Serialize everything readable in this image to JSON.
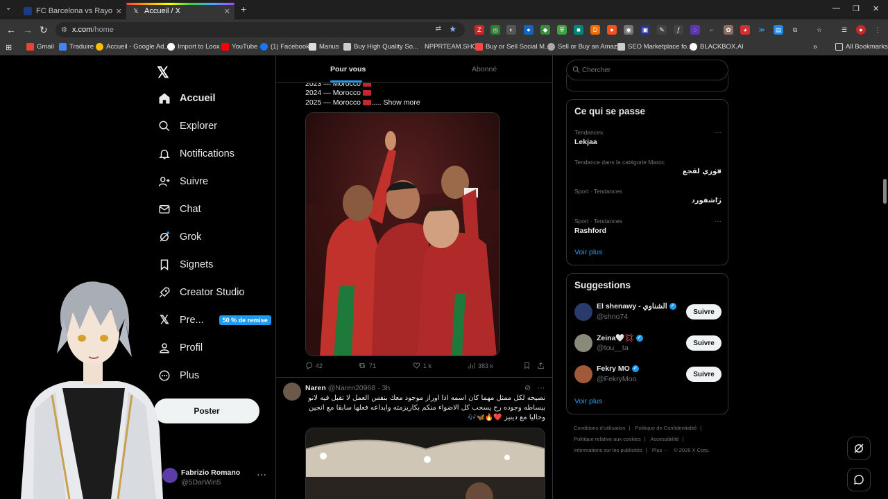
{
  "browser": {
    "tabs": [
      {
        "title": "FC Barcelona vs Rayo Vallecano",
        "active": false
      },
      {
        "title": "Accueil / X",
        "active": true
      }
    ],
    "new_tab": "+",
    "url_host": "x.com",
    "url_path": "/home",
    "window_controls": {
      "minimize": "—",
      "restore": "❐",
      "close": "✕"
    }
  },
  "bookmarks": [
    {
      "label": "Gmail",
      "color": "#ea4335"
    },
    {
      "label": "Traduire",
      "color": "#4285f4"
    },
    {
      "label": "Accueil - Google Ad...",
      "color": "#fbbc04"
    },
    {
      "label": "Import to Loox",
      "color": "#ffffff"
    },
    {
      "label": "YouTube",
      "color": "#ff0000"
    },
    {
      "label": "(1) Facebook",
      "color": "#1877f2"
    },
    {
      "label": "Manus",
      "color": "#dddddd"
    },
    {
      "label": "Buy High Quality So...",
      "color": "#cccccc"
    },
    {
      "label": "NPPRTEAM.SHOP",
      "color": "#353535"
    },
    {
      "label": "Buy or Sell Social M...",
      "color": "#f44"
    },
    {
      "label": "Sell or Buy an Amaz...",
      "color": "#aaa"
    },
    {
      "label": "SEO Marketplace fo...",
      "color": "#ccc"
    },
    {
      "label": "BLACKBOX.AI",
      "color": "#fff"
    }
  ],
  "all_bookmarks": "All Bookmarks",
  "sidebar": {
    "items": [
      {
        "label": "Accueil",
        "icon": "home-icon"
      },
      {
        "label": "Explorer",
        "icon": "search-icon"
      },
      {
        "label": "Notifications",
        "icon": "bell-icon"
      },
      {
        "label": "Suivre",
        "icon": "person-add-icon"
      },
      {
        "label": "Chat",
        "icon": "mail-icon"
      },
      {
        "label": "Grok",
        "icon": "grok-icon"
      },
      {
        "label": "Signets",
        "icon": "bookmark-icon"
      },
      {
        "label": "Creator Studio",
        "icon": "rocket-icon"
      },
      {
        "label": "Pre...",
        "icon": "x-logo-icon",
        "badge": "50 % de remise"
      },
      {
        "label": "Profil",
        "icon": "person-icon"
      },
      {
        "label": "Plus",
        "icon": "more-circle-icon"
      }
    ],
    "post_label": "Poster",
    "profile": {
      "name": "Fabrizio Romano",
      "handle": "@5DarWin5",
      "more": "···"
    }
  },
  "feed": {
    "tabs": [
      {
        "label": "Pour vous",
        "active": true
      },
      {
        "label": "Abonné",
        "active": false
      }
    ],
    "tweet1": {
      "lines": [
        "2023 — Morocco",
        "2024 — Morocco",
        "2025 — Morocco"
      ],
      "ellipsis": ".....",
      "show_more": "Show more",
      "stats": {
        "replies": "42",
        "reposts": "71",
        "likes": "1 k",
        "views": "383 k"
      }
    },
    "tweet2": {
      "name": "Naren",
      "handle": "@Naren20968",
      "time": "· 3h",
      "text_lines": [
        "نصيحه لكل ممثل مهما كان اسمه اذا اوراز موجود معك بنفس العمل لا تقبل فيه لانو",
        "ببساطه وجوده رح يسحب كل الاضواء منكم بكاريزمته وابداعه فعلها سابقا مع انجين",
        "وحاليا مع دينيز ❤️🔥🦋🎶"
      ]
    }
  },
  "right": {
    "search_placeholder": "Chercher",
    "trending_title": "Ce qui se passe",
    "trends": [
      {
        "category": "Tendances",
        "name": "Lekjaa",
        "rtl": false
      },
      {
        "category": "Tendance dans la catégorie Maroc",
        "name": "فوزي لقجع",
        "rtl": true
      },
      {
        "category": "Sport · Tendances",
        "name": "راشفورد",
        "rtl": true
      },
      {
        "category": "Sport · Tendances",
        "name": "Rashford",
        "rtl": false
      }
    ],
    "trend_more": "···",
    "see_more": "Voir plus",
    "suggestions_title": "Suggestions",
    "suggestions": [
      {
        "name": "El shenawy - الشناوي",
        "handle": "@shno74",
        "avatar_color": "#2a3a6a"
      },
      {
        "name": "Zeina🤍💢",
        "handle": "@tou__ta",
        "avatar_color": "#8a8a7a"
      },
      {
        "name": "Fekry MO",
        "handle": "@FekryMoo",
        "avatar_color": "#a05a3a"
      }
    ],
    "follow_label": "Suivre",
    "footer": [
      "Conditions d'utilisation",
      "|",
      "Politique de Confidentialité",
      "|",
      "Politique relative aux cookies",
      "|",
      "Accessibilité",
      "|",
      "Informations sur les publicités",
      "|",
      "Plus ···",
      "© 2026 X Corp."
    ]
  },
  "colors": {
    "accent": "#1d9bf0",
    "bg": "#000000",
    "text": "#e7e9ea",
    "muted": "#71767b",
    "border": "#2f3336"
  }
}
